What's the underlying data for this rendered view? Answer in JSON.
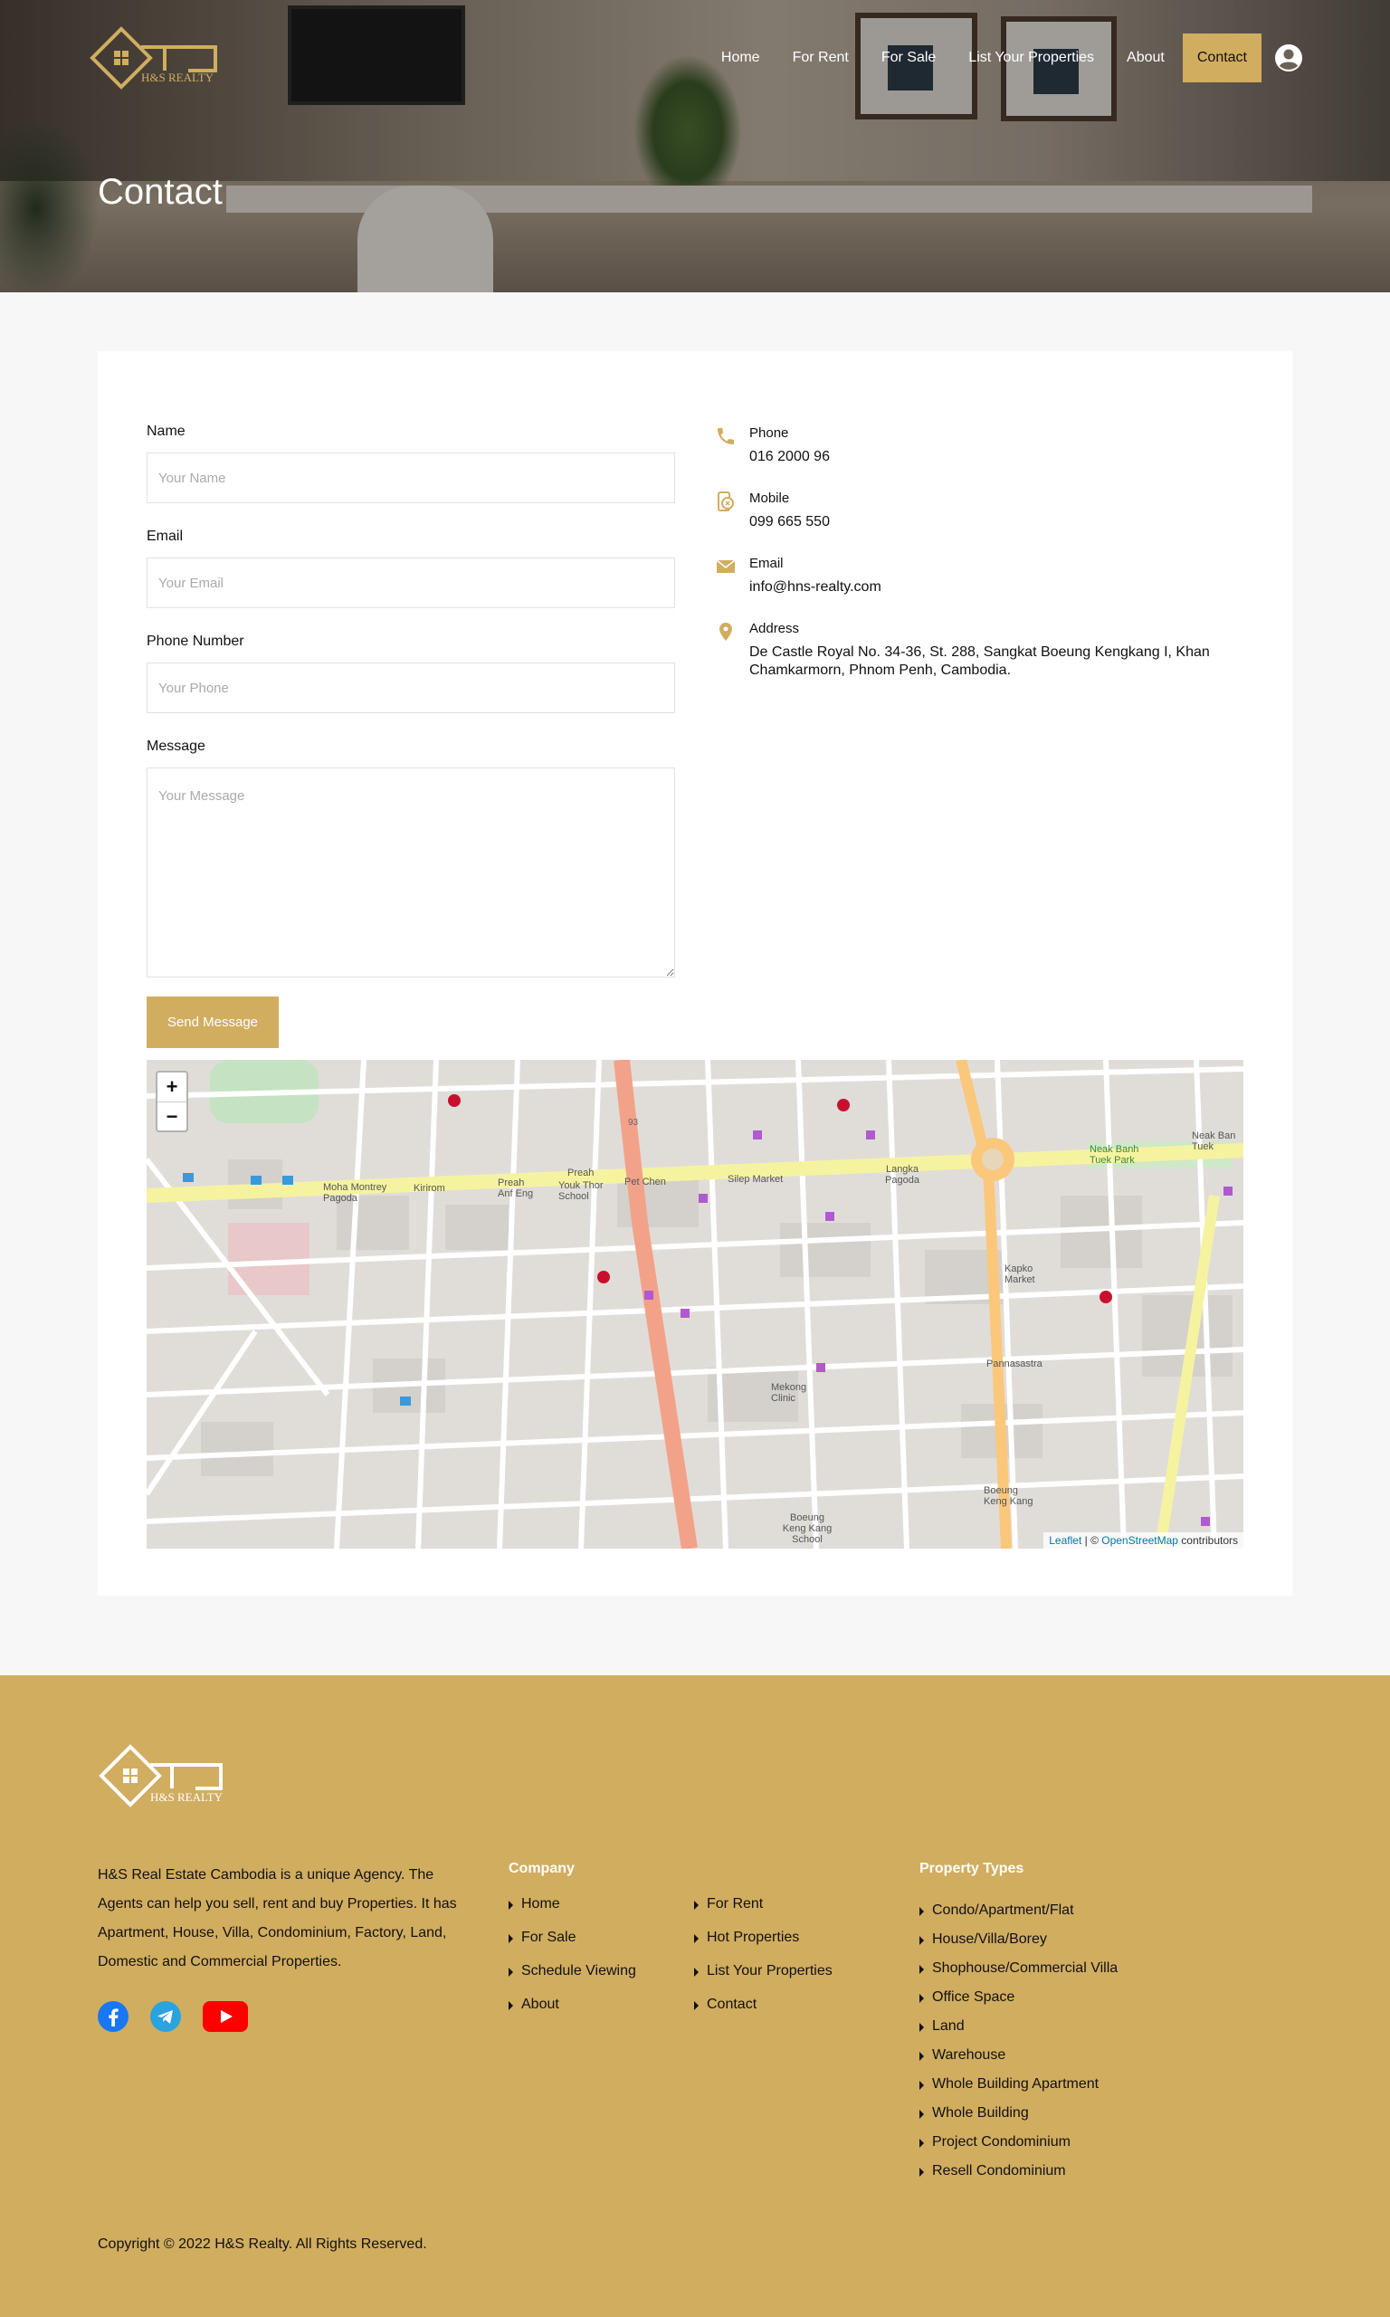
{
  "brand": {
    "name": "H&S REALTY",
    "gold": "#d1ad60"
  },
  "nav": {
    "items": [
      "Home",
      "For Rent",
      "For Sale",
      "List Your Properties",
      "About"
    ],
    "contact_label": "Contact",
    "user_icon": "user-circle-icon"
  },
  "hero": {
    "title": "Contact"
  },
  "form": {
    "name_label": "Name",
    "name_placeholder": "Your Name",
    "email_label": "Email",
    "email_placeholder": "Your Email",
    "phone_label": "Phone Number",
    "phone_placeholder": "Your Phone",
    "message_label": "Message",
    "message_placeholder": "Your Message",
    "send_label": "Send Message"
  },
  "info": {
    "phone_label": "Phone",
    "phone_value": "016 2000 96",
    "mobile_label": "Mobile",
    "mobile_value": "099 665 550",
    "email_label": "Email",
    "email_value": "info@hns-realty.com",
    "address_label": "Address",
    "address_value": "De Castle Royal No. 34-36, St. 288, Sangkat Boeung Kengkang I, Khan Chamkarmorn, Phnom Penh, Cambodia."
  },
  "map": {
    "zoom_in": "+",
    "zoom_out": "−",
    "attr_leaflet": "Leaflet",
    "attr_sep": " | © ",
    "attr_osm": "OpenStreetMap",
    "attr_tail": " contributors",
    "labels": [
      "Moha Montrey Pagoda",
      "Kirirom",
      "Preah Anf Eng",
      "Youk Thor School",
      "Preah",
      "Pet Chen",
      "Silep Market",
      "Langka Pagoda",
      "Neak Banh Tuek Park",
      "Neak Ban Tuek",
      "Kapko Market",
      "Pannasastra",
      "Mekong Clinic",
      "Boeung Keng Kang",
      "Boeung Keng Kang School",
      "93"
    ]
  },
  "footer": {
    "about": "H&S Real Estate Cambodia is a unique Agency. The Agents can help you sell, rent and buy Properties. It has Apartment, House, Villa, Condominium, Factory, Land, Domestic and Commercial Properties.",
    "company_title": "Company",
    "company_col1": [
      "Home",
      "For Sale",
      "Schedule Viewing",
      "About"
    ],
    "company_col2": [
      "For Rent",
      "Hot Properties",
      "List Your Properties",
      "Contact"
    ],
    "types_title": "Property Types",
    "types": [
      "Condo/Apartment/Flat",
      "House/Villa/Borey",
      "Shophouse/Commercial Villa",
      "Office Space",
      "Land",
      "Warehouse",
      "Whole Building Apartment",
      "Whole Building",
      "Project Condominium",
      "Resell Condominium"
    ],
    "social": [
      "facebook-icon",
      "telegram-icon",
      "youtube-icon"
    ],
    "copyright": "Copyright © 2022 H&S Realty. All Rights Reserved."
  }
}
